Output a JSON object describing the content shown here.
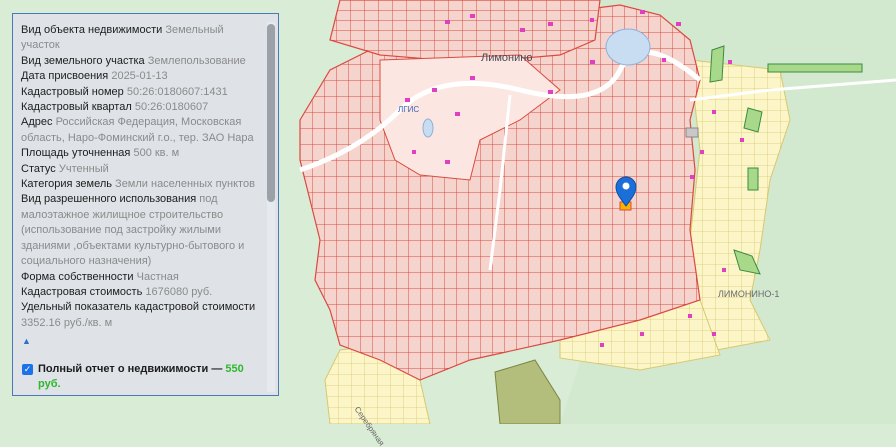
{
  "map": {
    "place_label": "Лимонино",
    "place_label_2": "ЛИМОНИНО-1",
    "road_label": "Серебряная",
    "small_label": "ЛГИС",
    "marker_icon": "map-pin-icon",
    "colors": {
      "background": "#d9ecd6",
      "parcel_fill": "#f6d4ce",
      "parcel_stroke": "#d94a40",
      "water": "#c8dcf2",
      "road": "#ffffff",
      "accent_pink": "#e040c0",
      "yellow": "#fbf5c8",
      "green_parcel": "#a8d98a",
      "marker": "#1a6fd8"
    }
  },
  "info": {
    "fields": [
      {
        "key": "Вид объекта недвижимости",
        "value": "Земельный участок"
      },
      {
        "key": "Вид земельного участка",
        "value": "Землепользование"
      },
      {
        "key": "Дата присвоения",
        "value": "2025-01-13"
      },
      {
        "key": "Кадастровый номер",
        "value": "50:26:0180607:1431"
      },
      {
        "key": "Кадастровый квартал",
        "value": "50:26:0180607"
      },
      {
        "key": "Адрес",
        "value": "Российская Федерация, Московская область, Наро-Фоминский г.о., тер. ЗАО Нара"
      },
      {
        "key": "Площадь уточненная",
        "value": "500 кв. м"
      },
      {
        "key": "Статус",
        "value": "Учтенный"
      },
      {
        "key": "Категория земель",
        "value": "Земли населенных пунктов"
      },
      {
        "key": "Вид разрешенного использования",
        "value": "под малоэтажное жилищное строительство (использование под застройку жилыми зданиями ,объектами культурно-бытового и социального назначения)"
      },
      {
        "key": "Форма собственности",
        "value": "Частная"
      },
      {
        "key": "Кадастровая стоимость",
        "value": "1676080 руб."
      },
      {
        "key": "Удельный показатель кадастровой стоимости",
        "value": "3352.16 руб./кв. м"
      }
    ],
    "collapse_icon": "▲",
    "report": {
      "checked": true,
      "text": "Полный отчет о недвижимости — ",
      "price": "550 руб."
    },
    "more_text": "Кадастровая стоимость"
  }
}
